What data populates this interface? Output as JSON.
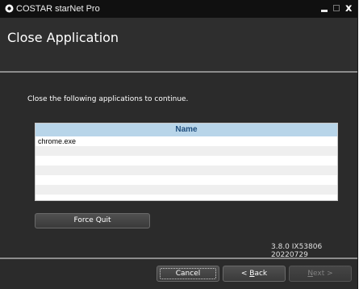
{
  "window": {
    "title": "COSTAR starNet Pro",
    "close_glyph": "x"
  },
  "page": {
    "title": "Close Application",
    "instruction": "Close the following applications to continue."
  },
  "table": {
    "header": "Name",
    "rows": [
      "chrome.exe",
      "",
      "",
      "",
      "",
      "",
      ""
    ]
  },
  "buttons": {
    "force_quit": "Force Quit",
    "cancel": "Cancel",
    "back_prefix": "< ",
    "back_key": "B",
    "back_rest": "ack",
    "next_key": "N",
    "next_rest": "ext >"
  },
  "version": "3.8.0 IX53806 20220729",
  "colors": {
    "titlebar": "#101010",
    "body": "#2b2b2b",
    "table_header": "#b8d5e9",
    "table_header_text": "#1e4e7e"
  }
}
